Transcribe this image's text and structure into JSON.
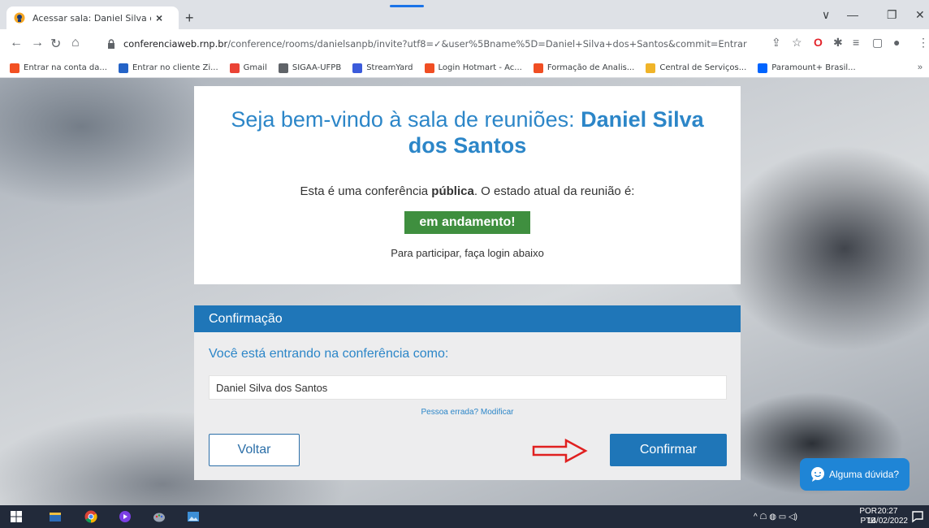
{
  "browser": {
    "tab_title": "Acessar sala: Daniel Silva dos San",
    "tab_close": "×",
    "new_tab": "+",
    "url_host": "conferenciaweb.rnp.br",
    "url_path": "/conference/rooms/danielsanpb/invite?utf8=✓&user%5Bname%5D=Daniel+Silva+dos+Santos&commit=Entrar",
    "win_min": "—",
    "win_restore": "❐",
    "win_close": "✕",
    "chevron": "∨"
  },
  "bookmarks": [
    {
      "label": "Entrar na conta da...",
      "color": "#f25022"
    },
    {
      "label": "Entrar no cliente Zi...",
      "color": "#2463c7"
    },
    {
      "label": "Gmail",
      "color": "#ea4335"
    },
    {
      "label": "SIGAA-UFPB",
      "color": "#5f6368"
    },
    {
      "label": "StreamYard",
      "color": "#3b5bdb"
    },
    {
      "label": "Login Hotmart - Ac...",
      "color": "#f04e23"
    },
    {
      "label": "Formação de Analis...",
      "color": "#f04e23"
    },
    {
      "label": "Central de Serviços...",
      "color": "#f0b429"
    },
    {
      "label": "Paramount+ Brasil...",
      "color": "#0064ff"
    }
  ],
  "bookmarks_more": "»",
  "welcome": {
    "title_prefix": "Seja bem-vindo à sala de reuniões: ",
    "title_name": "Daniel Silva dos Santos",
    "status_prefix": "Esta é uma conferência ",
    "status_bold": "pública",
    "status_suffix": ". O estado atual da reunião é:",
    "badge": "em andamento!",
    "hint": "Para participar, faça login abaixo"
  },
  "confirm": {
    "header": "Confirmação",
    "subtitle": "Você está entrando na conferência como:",
    "name_value": "Daniel Silva dos Santos",
    "wrong_person": "Pessoa errada? Modificar",
    "back_label": "Voltar",
    "confirm_label": "Confirmar"
  },
  "help": {
    "label": "Alguma dúvida?"
  },
  "taskbar": {
    "lang_line1": "POR",
    "lang_line2": "PTB",
    "time": "20:27",
    "date": "14/02/2022",
    "tray_icons": "^  ☖  ◍  ▭  ◁)"
  }
}
